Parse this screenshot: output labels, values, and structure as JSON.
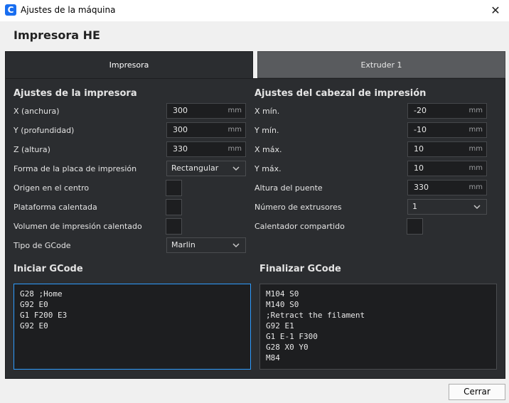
{
  "window": {
    "title": "Ajustes de la máquina",
    "app_icon_letter": "C"
  },
  "printer_name": "Impresora HE",
  "tabs": [
    {
      "label": "Impresora",
      "active": true
    },
    {
      "label": "Extruder 1",
      "active": false
    }
  ],
  "printer_settings": {
    "title": "Ajustes de la impresora",
    "x_label": "X (anchura)",
    "x_value": "300",
    "x_unit": "mm",
    "y_label": "Y (profundidad)",
    "y_value": "300",
    "y_unit": "mm",
    "z_label": "Z (altura)",
    "z_value": "330",
    "z_unit": "mm",
    "bed_shape_label": "Forma de la placa de impresión",
    "bed_shape_value": "Rectangular",
    "origin_center_label": "Origen en el centro",
    "origin_center_checked": false,
    "heated_bed_label": "Plataforma calentada",
    "heated_bed_checked": false,
    "heated_volume_label": "Volumen de impresión calentado",
    "heated_volume_checked": false,
    "gcode_flavor_label": "Tipo de GCode",
    "gcode_flavor_value": "Marlin"
  },
  "printhead_settings": {
    "title": "Ajustes del cabezal de impresión",
    "xmin_label": "X mín.",
    "xmin_value": "-20",
    "xmin_unit": "mm",
    "ymin_label": "Y mín.",
    "ymin_value": "-10",
    "ymin_unit": "mm",
    "xmax_label": "X máx.",
    "xmax_value": "10",
    "xmax_unit": "mm",
    "ymax_label": "Y máx.",
    "ymax_value": "10",
    "ymax_unit": "mm",
    "gantry_label": "Altura del puente",
    "gantry_value": "330",
    "gantry_unit": "mm",
    "extruders_label": "Número de extrusores",
    "extruders_value": "1",
    "shared_heater_label": "Calentador compartido",
    "shared_heater_checked": false
  },
  "start_gcode": {
    "title": "Iniciar GCode",
    "code": "G28 ;Home\nG92 E0\nG1 F200 E3\nG92 E0"
  },
  "end_gcode": {
    "title": "Finalizar GCode",
    "code": "M104 S0\nM140 S0\n;Retract the filament\nG92 E1\nG1 E-1 F300\nG28 X0 Y0\nM84"
  },
  "close_button_label": "Cerrar",
  "colors": {
    "panel_bg": "#2b2d30",
    "field_bg": "#1d1e20",
    "focus_border": "#2e9cff",
    "app_icon": "#196ef0"
  }
}
